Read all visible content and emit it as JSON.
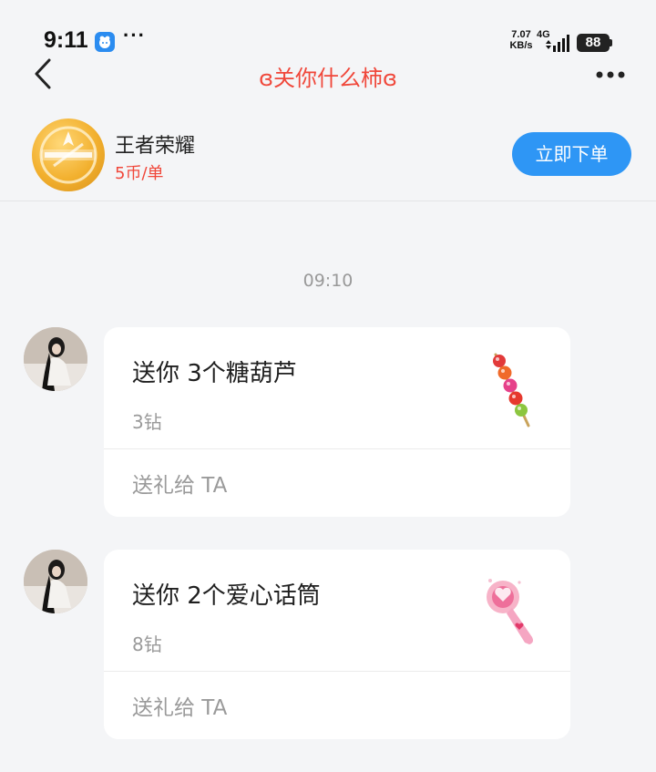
{
  "status_bar": {
    "time": "9:11",
    "app_icon": "chat-app-icon",
    "more_dots": "···",
    "net_speed_value": "7.07",
    "net_speed_unit": "KB/s",
    "network_type": "4G",
    "battery": "88"
  },
  "header": {
    "title": "ɞ关你什么柿ɞ",
    "back_icon": "chevron-left-icon",
    "more_icon": "more-horizontal-icon"
  },
  "game_card": {
    "name": "王者荣耀",
    "price": "5币/单",
    "order_button": "立即下单"
  },
  "chat": {
    "timestamp": "09:10",
    "messages": [
      {
        "title": "送你 3个糖葫芦",
        "cost": "3钻",
        "action": "送礼给 TA",
        "gift_icon": "candied-haws-icon"
      },
      {
        "title": "送你 2个爱心话筒",
        "cost": "8钻",
        "action": "送礼给 TA",
        "gift_icon": "heart-microphone-icon"
      }
    ]
  },
  "colors": {
    "accent_red": "#f0473a",
    "button_blue": "#2e96f5",
    "background": "#f4f5f7"
  }
}
